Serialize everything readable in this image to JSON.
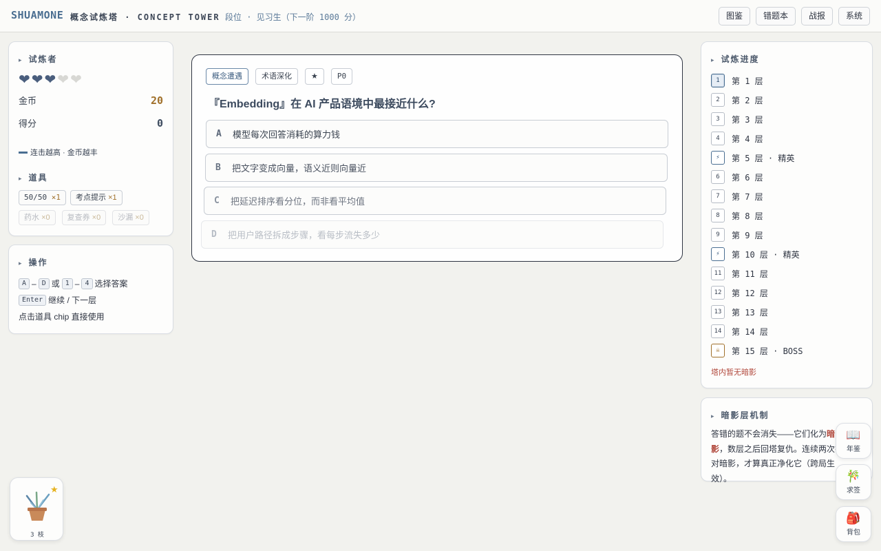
{
  "topbar": {
    "brand": "SHUAMONE",
    "tower_title": "概念试炼塔 · CONCEPT TOWER",
    "rank": "段位 · 见习生（下一阶 1000 分）",
    "nav": [
      "图鉴",
      "错题本",
      "战报",
      "系统"
    ]
  },
  "player": {
    "title": "试炼者",
    "hearts_full": 3,
    "hearts_total": 5,
    "coins_label": "金币",
    "coins": "20",
    "score_label": "得分",
    "score": "0",
    "streak_text": "连击越高 · 金币越丰",
    "items_title": "道具",
    "items": [
      {
        "name": "50/50",
        "count": "×1"
      },
      {
        "name": "考点提示",
        "count": "×1"
      },
      {
        "name": "药水",
        "count": "×0"
      },
      {
        "name": "复查券",
        "count": "×0"
      },
      {
        "name": "沙漏",
        "count": "×0"
      }
    ]
  },
  "ops": {
    "title": "操作",
    "key_a": "A",
    "key_d": "D",
    "or": "或",
    "key_1": "1",
    "key_4": "4",
    "select_text": "选择答案",
    "key_enter": "Enter",
    "continue_text": "继续 / 下一层",
    "chip_text": "点击道具 chip 直接使用"
  },
  "quiz": {
    "tags": [
      "概念遭遇",
      "术语深化",
      "★",
      "P0"
    ],
    "question": "『Embedding』在 AI 产品语境中最接近什么?",
    "options": [
      {
        "letter": "A",
        "text": "模型每次回答消耗的算力钱"
      },
      {
        "letter": "B",
        "text": "把文字变成向量，语义近则向量近"
      },
      {
        "letter": "C",
        "text": "把延迟排序看分位，而非看平均值"
      },
      {
        "letter": "D",
        "text": "把用户路径拆成步骤，看每步流失多少"
      }
    ]
  },
  "progress": {
    "title": "试炼进度",
    "floors": [
      {
        "box": "1",
        "label": "第 1 层",
        "kind": "current"
      },
      {
        "box": "2",
        "label": "第 2 层",
        "kind": "normal"
      },
      {
        "box": "3",
        "label": "第 3 层",
        "kind": "normal"
      },
      {
        "box": "4",
        "label": "第 4 层",
        "kind": "normal"
      },
      {
        "box": "⚡",
        "label": "第 5 层 · 精英",
        "kind": "elite"
      },
      {
        "box": "6",
        "label": "第 6 层",
        "kind": "normal"
      },
      {
        "box": "7",
        "label": "第 7 层",
        "kind": "normal"
      },
      {
        "box": "8",
        "label": "第 8 层",
        "kind": "normal"
      },
      {
        "box": "9",
        "label": "第 9 层",
        "kind": "normal"
      },
      {
        "box": "⚡",
        "label": "第 10 层 · 精英",
        "kind": "elite"
      },
      {
        "box": "11",
        "label": "第 11 层",
        "kind": "normal"
      },
      {
        "box": "12",
        "label": "第 12 层",
        "kind": "normal"
      },
      {
        "box": "13",
        "label": "第 13 层",
        "kind": "normal"
      },
      {
        "box": "14",
        "label": "第 14 层",
        "kind": "normal"
      },
      {
        "box": "☠",
        "label": "第 15 层 · BOSS",
        "kind": "boss"
      }
    ],
    "shadow_note": "塔内暂无暗影"
  },
  "mechanism": {
    "title": "暗影层机制",
    "text_before": "答错的题不会消失——它们化为",
    "text_bold": "暗影",
    "text_after": "，数层之后回塔复仇。连续两次答对暗影，才算真正净化它（跨局生效）。"
  },
  "dock": [
    {
      "icon": "book-icon",
      "glyph": "📖",
      "label": "年鉴"
    },
    {
      "icon": "fortune-stick-icon",
      "glyph": "🎋",
      "label": "求签"
    },
    {
      "icon": "backpack-icon",
      "glyph": "🎒",
      "label": "背包"
    }
  ],
  "plant": {
    "label": "3 枝"
  },
  "colors": {
    "accent": "#4a6e91",
    "coin": "#a0702a",
    "danger": "#b24a3e",
    "background": "#f2f2ee"
  }
}
